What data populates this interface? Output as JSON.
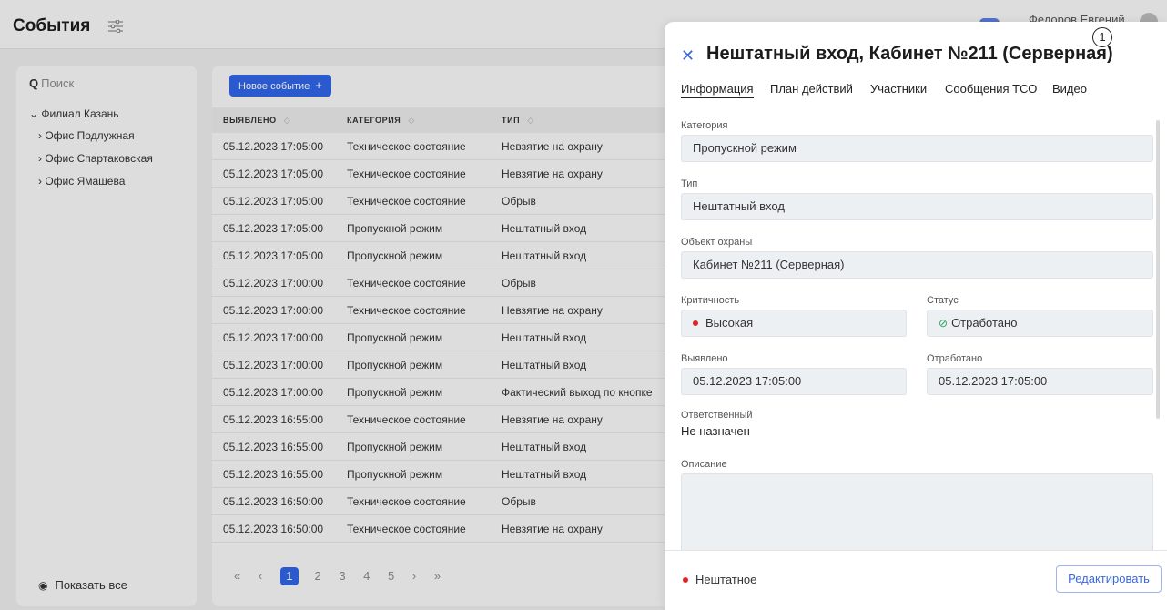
{
  "header": {
    "title": "События",
    "user_name": "Федоров Евгений"
  },
  "sidebar": {
    "search_placeholder": "Поиск",
    "root": "Филиал Казань",
    "items": [
      "Офис Подлужная",
      "Офис Спартаковская",
      "Офис Ямашева"
    ],
    "show_all": "Показать все"
  },
  "events": {
    "new_button": "Новое событие",
    "columns": [
      "Выявлено",
      "Категория",
      "Тип"
    ],
    "rows": [
      [
        "05.12.2023 17:05:00",
        "Техническое состояние",
        "Невзятие на охрану"
      ],
      [
        "05.12.2023 17:05:00",
        "Техническое состояние",
        "Невзятие на охрану"
      ],
      [
        "05.12.2023 17:05:00",
        "Техническое состояние",
        "Обрыв"
      ],
      [
        "05.12.2023 17:05:00",
        "Пропускной режим",
        "Нештатный вход"
      ],
      [
        "05.12.2023 17:05:00",
        "Пропускной режим",
        "Нештатный вход"
      ],
      [
        "05.12.2023 17:00:00",
        "Техническое состояние",
        "Обрыв"
      ],
      [
        "05.12.2023 17:00:00",
        "Техническое состояние",
        "Невзятие на охрану"
      ],
      [
        "05.12.2023 17:00:00",
        "Пропускной режим",
        "Нештатный вход"
      ],
      [
        "05.12.2023 17:00:00",
        "Пропускной режим",
        "Нештатный вход"
      ],
      [
        "05.12.2023 17:00:00",
        "Пропускной режим",
        "Фактический выход по кнопке"
      ],
      [
        "05.12.2023 16:55:00",
        "Техническое состояние",
        "Невзятие на охрану"
      ],
      [
        "05.12.2023 16:55:00",
        "Пропускной режим",
        "Нештатный вход"
      ],
      [
        "05.12.2023 16:55:00",
        "Пропускной режим",
        "Нештатный вход"
      ],
      [
        "05.12.2023 16:50:00",
        "Техническое состояние",
        "Обрыв"
      ],
      [
        "05.12.2023 16:50:00",
        "Техническое состояние",
        "Невзятие на охрану"
      ]
    ],
    "pagination": {
      "first": "«",
      "prev": "‹",
      "pages": [
        "1",
        "2",
        "3",
        "4",
        "5"
      ],
      "current": "1",
      "next": "›",
      "last": "»"
    }
  },
  "drawer": {
    "title": "Нештатный вход, Кабинет №211 (Серверная)",
    "marker": "1",
    "tabs": [
      "Информация",
      "План действий",
      "Участники",
      "Сообщения ТСО",
      "Видео"
    ],
    "active_tab": "Информация",
    "fields": {
      "category_label": "Категория",
      "category_value": "Пропускной режим",
      "type_label": "Тип",
      "type_value": "Нештатный вход",
      "object_label": "Объект охраны",
      "object_value": "Кабинет №211 (Серверная)",
      "criticality_label": "Критичность",
      "criticality_value": "Высокая",
      "status_label": "Статус",
      "status_value": "Отработано",
      "detected_label": "Выявлено",
      "detected_value": "05.12.2023 17:05:00",
      "processed_label": "Отработано",
      "processed_value": "05.12.2023 17:05:00",
      "responsible_label": "Ответственный",
      "responsible_value": "Не назначен",
      "description_label": "Описание",
      "description_value": ""
    },
    "footer": {
      "status": "Нештатное",
      "edit_button": "Редактировать"
    },
    "colors": {
      "accent": "#3a66e0",
      "critical": "#e02424",
      "ok": "#2ca060"
    }
  }
}
